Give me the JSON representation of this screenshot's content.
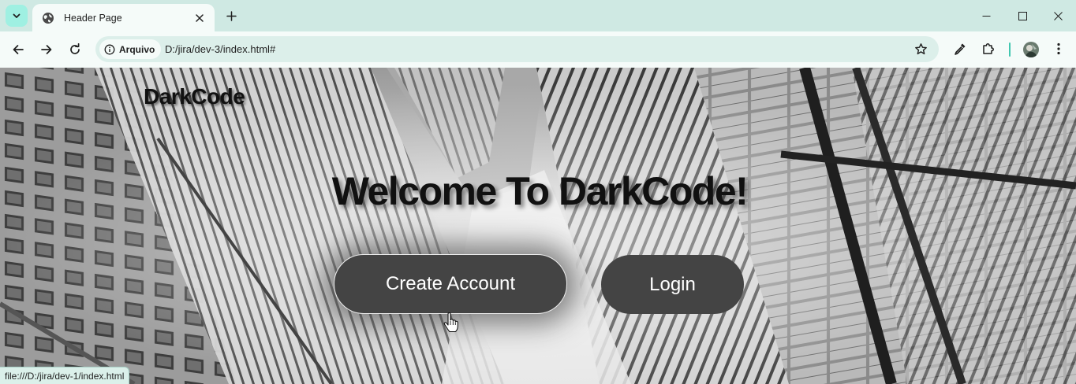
{
  "browser": {
    "tab": {
      "title": "Header Page",
      "favicon": "globe-icon"
    },
    "security_chip": "Arquivo",
    "url": "D:/jira/dev-3/index.html#",
    "status_url": "file:///D:/jira/dev-1/index.html",
    "colors": {
      "frame": "#cfe9e3",
      "toolbar": "#f5fbf9",
      "omnibox": "#dcefea"
    }
  },
  "page": {
    "logo": "DarkCode",
    "hero_title": "Welcome To DarkCode!",
    "buttons": {
      "create_account": "Create Account",
      "login": "Login"
    },
    "colors": {
      "button_bg": "#444444",
      "button_text": "#ffffff",
      "heading": "#111111"
    }
  }
}
